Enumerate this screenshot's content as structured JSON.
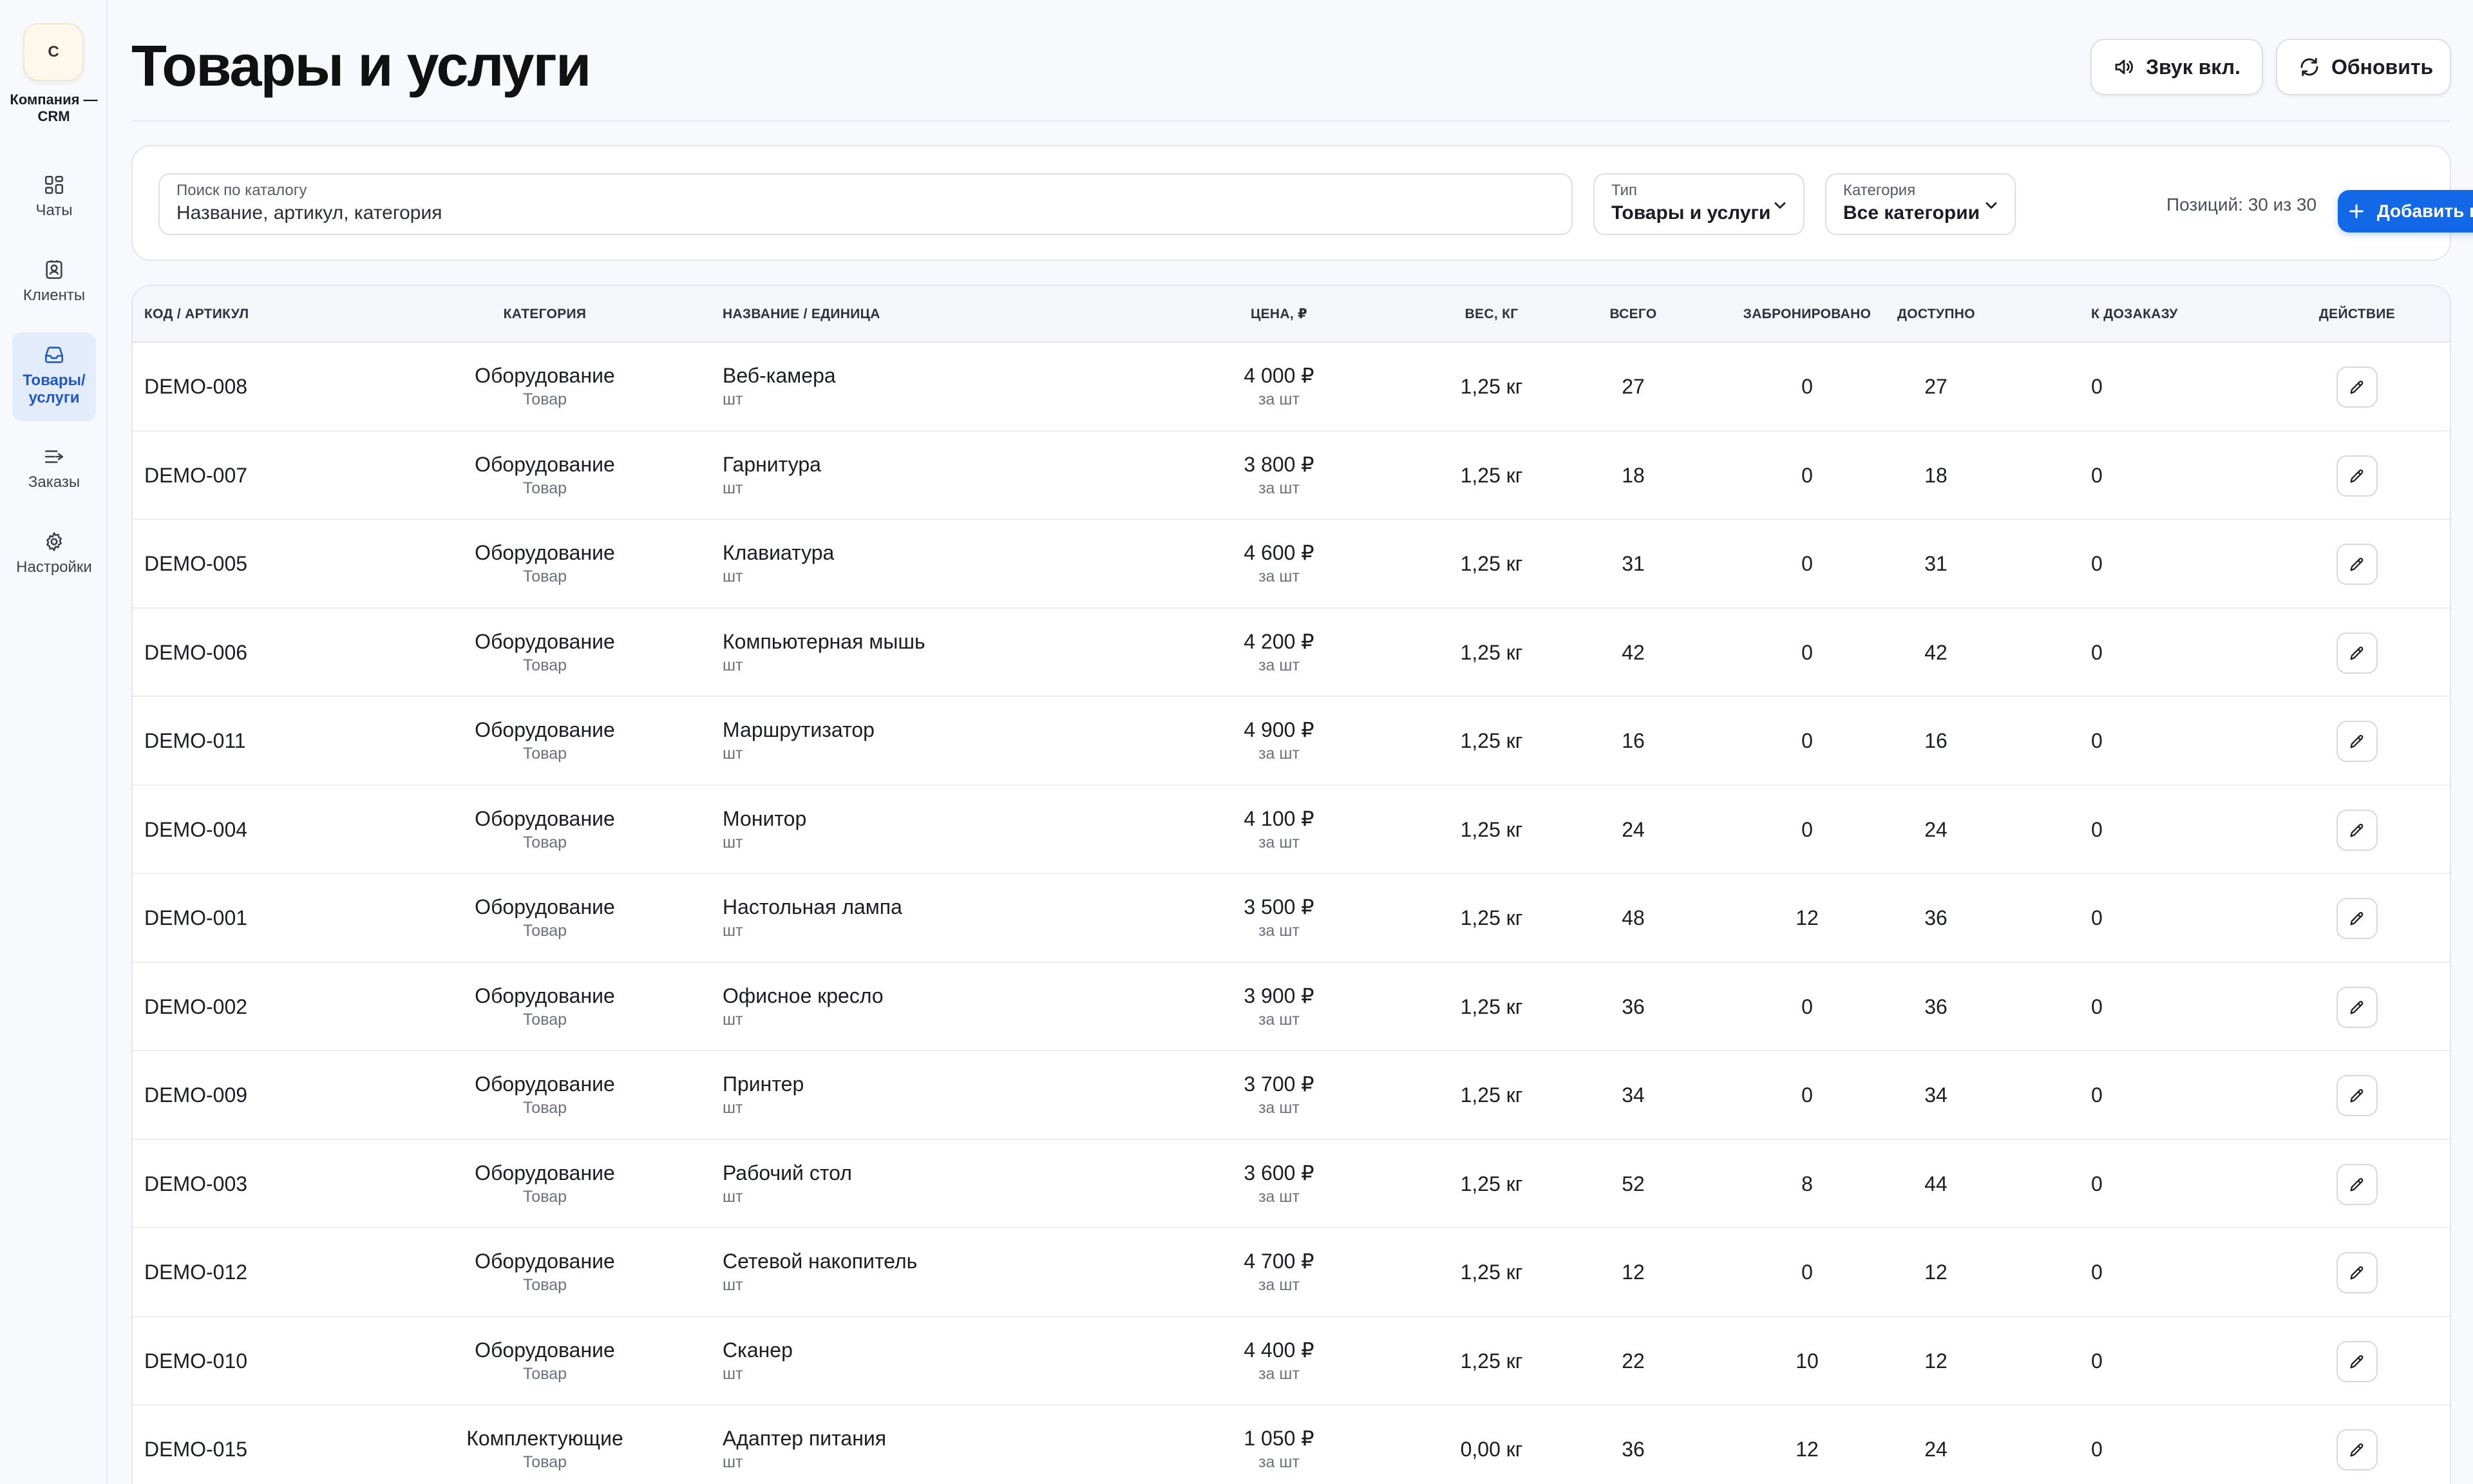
{
  "company": {
    "avatar_letter": "C",
    "name": "Компания — CRM"
  },
  "sidebar": {
    "items": [
      {
        "label": "Чаты",
        "icon": "grid-icon"
      },
      {
        "label": "Клиенты",
        "icon": "contact-icon"
      },
      {
        "label": "Товары/ услуги",
        "icon": "inbox-icon",
        "active": true
      },
      {
        "label": "Заказы",
        "icon": "list-arrow-icon"
      },
      {
        "label": "Настройки",
        "icon": "gear-icon"
      }
    ]
  },
  "header": {
    "title": "Товары и услуги",
    "sound_button": "Звук вкл.",
    "refresh_button": "Обновить"
  },
  "filters": {
    "search_label": "Поиск по каталогу",
    "search_placeholder": "Название, артикул, категория",
    "type_label": "Тип",
    "type_value": "Товары и услуги",
    "category_label": "Категория",
    "category_value": "Все категории",
    "count_text": "Позиций: 30 из 30",
    "add_button": "Добавить позицию"
  },
  "table": {
    "columns": [
      "КОД / АРТИКУЛ",
      "КАТЕГОРИЯ",
      "НАЗВАНИЕ / ЕДИНИЦА",
      "ЦЕНА, ₽",
      "ВЕС, КГ",
      "ВСЕГО",
      "ЗАБРОНИРОВАНО",
      "ДОСТУПНО",
      "К ДОЗАКАЗУ",
      "ДЕЙСТВИЕ"
    ],
    "rows": [
      {
        "code": "DEMO-008",
        "category": "Оборудование",
        "type": "Товар",
        "name": "Веб-камера",
        "unit": "шт",
        "price": "4 000 ₽",
        "price_unit": "за шт",
        "weight": "1,25 кг",
        "total": "27",
        "reserved": "0",
        "available": "27",
        "to_order": "0"
      },
      {
        "code": "DEMO-007",
        "category": "Оборудование",
        "type": "Товар",
        "name": "Гарнитура",
        "unit": "шт",
        "price": "3 800 ₽",
        "price_unit": "за шт",
        "weight": "1,25 кг",
        "total": "18",
        "reserved": "0",
        "available": "18",
        "to_order": "0"
      },
      {
        "code": "DEMO-005",
        "category": "Оборудование",
        "type": "Товар",
        "name": "Клавиатура",
        "unit": "шт",
        "price": "4 600 ₽",
        "price_unit": "за шт",
        "weight": "1,25 кг",
        "total": "31",
        "reserved": "0",
        "available": "31",
        "to_order": "0"
      },
      {
        "code": "DEMO-006",
        "category": "Оборудование",
        "type": "Товар",
        "name": "Компьютерная мышь",
        "unit": "шт",
        "price": "4 200 ₽",
        "price_unit": "за шт",
        "weight": "1,25 кг",
        "total": "42",
        "reserved": "0",
        "available": "42",
        "to_order": "0"
      },
      {
        "code": "DEMO-011",
        "category": "Оборудование",
        "type": "Товар",
        "name": "Маршрутизатор",
        "unit": "шт",
        "price": "4 900 ₽",
        "price_unit": "за шт",
        "weight": "1,25 кг",
        "total": "16",
        "reserved": "0",
        "available": "16",
        "to_order": "0"
      },
      {
        "code": "DEMO-004",
        "category": "Оборудование",
        "type": "Товар",
        "name": "Монитор",
        "unit": "шт",
        "price": "4 100 ₽",
        "price_unit": "за шт",
        "weight": "1,25 кг",
        "total": "24",
        "reserved": "0",
        "available": "24",
        "to_order": "0"
      },
      {
        "code": "DEMO-001",
        "category": "Оборудование",
        "type": "Товар",
        "name": "Настольная лампа",
        "unit": "шт",
        "price": "3 500 ₽",
        "price_unit": "за шт",
        "weight": "1,25 кг",
        "total": "48",
        "reserved": "12",
        "available": "36",
        "to_order": "0"
      },
      {
        "code": "DEMO-002",
        "category": "Оборудование",
        "type": "Товар",
        "name": "Офисное кресло",
        "unit": "шт",
        "price": "3 900 ₽",
        "price_unit": "за шт",
        "weight": "1,25 кг",
        "total": "36",
        "reserved": "0",
        "available": "36",
        "to_order": "0"
      },
      {
        "code": "DEMO-009",
        "category": "Оборудование",
        "type": "Товар",
        "name": "Принтер",
        "unit": "шт",
        "price": "3 700 ₽",
        "price_unit": "за шт",
        "weight": "1,25 кг",
        "total": "34",
        "reserved": "0",
        "available": "34",
        "to_order": "0"
      },
      {
        "code": "DEMO-003",
        "category": "Оборудование",
        "type": "Товар",
        "name": "Рабочий стол",
        "unit": "шт",
        "price": "3 600 ₽",
        "price_unit": "за шт",
        "weight": "1,25 кг",
        "total": "52",
        "reserved": "8",
        "available": "44",
        "to_order": "0"
      },
      {
        "code": "DEMO-012",
        "category": "Оборудование",
        "type": "Товар",
        "name": "Сетевой накопитель",
        "unit": "шт",
        "price": "4 700 ₽",
        "price_unit": "за шт",
        "weight": "1,25 кг",
        "total": "12",
        "reserved": "0",
        "available": "12",
        "to_order": "0"
      },
      {
        "code": "DEMO-010",
        "category": "Оборудование",
        "type": "Товар",
        "name": "Сканер",
        "unit": "шт",
        "price": "4 400 ₽",
        "price_unit": "за шт",
        "weight": "1,25 кг",
        "total": "22",
        "reserved": "10",
        "available": "12",
        "to_order": "0"
      },
      {
        "code": "DEMO-015",
        "category": "Комплектующие",
        "type": "Товар",
        "name": "Адаптер питания",
        "unit": "шт",
        "price": "1 050 ₽",
        "price_unit": "за шт",
        "weight": "0,00 кг",
        "total": "36",
        "reserved": "12",
        "available": "24",
        "to_order": "0"
      }
    ]
  },
  "colors": {
    "accent": "#1268e6",
    "active_nav_bg": "#e3ecfb",
    "active_nav_text": "#1f57c9"
  }
}
